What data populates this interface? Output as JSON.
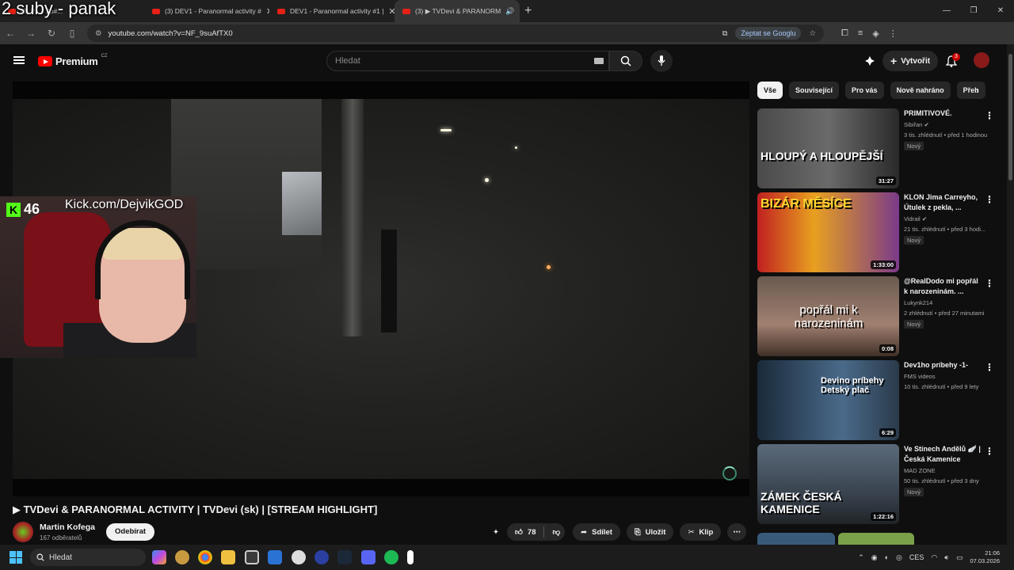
{
  "overlay_text": "2 suby - panak",
  "browser": {
    "tabs": [
      {
        "label": "(3) Ps... 2p#...",
        "active": false
      },
      {
        "label": "(3) DEV1 - Paranormal activity #",
        "active": false
      },
      {
        "label": "DEV1 - Paranormal activity #1 |",
        "active": false
      },
      {
        "label": "(3) ▶ TVDevi & PARANORM",
        "active": true
      }
    ],
    "url": "youtube.com/watch?v=NF_9suAfTX0",
    "ask_google": "Zeptat se Googlu"
  },
  "yt": {
    "logo": "Premium",
    "logo_region": "CZ",
    "search_placeholder": "Hledat",
    "create_label": "Vytvořit",
    "notif_count": "3"
  },
  "webcam": {
    "kick_count": "46",
    "kick_url": "Kick.com/DejvikGOD"
  },
  "video": {
    "title": "▶ TVDevi & PARANORMAL ACTIVITY | TVDevi (sk) | [STREAM HIGHLIGHT]",
    "channel": "Martin Kofega",
    "subs": "167 odběratelů",
    "subscribe": "Odebírat",
    "likes": "78",
    "share": "Sdílet",
    "save": "Uložit",
    "clip": "Klip"
  },
  "chips": [
    "Vše",
    "Související",
    "Pro vás",
    "Nově nahráno",
    "Přeh"
  ],
  "recommendations": [
    {
      "title": "PRIMITIVOVÉ.",
      "channel": "Sibiřan",
      "verified": true,
      "meta": "3 tis. zhlédnutí • před 1 hodinou",
      "badge": "Nový",
      "duration": "31:27",
      "thumb_text": "HLOUPÝ A HLOUPĚJŠÍ"
    },
    {
      "title": "KLON Jima Carreyho, Útulek z pekla, ...",
      "channel": "Vidrail",
      "verified": true,
      "meta": "21 tis. zhlédnutí • před 3 hodi...",
      "badge": "Nový",
      "duration": "1:33:00",
      "thumb_text": "BIZÁR MĚSÍCE"
    },
    {
      "title": "@RealDodo mi popřál k narozeninám. ...",
      "channel": "Lukynk214",
      "verified": false,
      "meta": "2 zhlédnutí • před 27 minutami",
      "badge": "Nový",
      "duration": "0:08",
      "thumb_text": "popřál mi k narozeninám"
    },
    {
      "title": "Dev1ho príbehy -1-",
      "channel": "FMS videos",
      "verified": false,
      "meta": "10 tis. zhlédnutí • před 9 lety",
      "badge": "",
      "duration": "6:29",
      "thumb_text": "Devino príbehy Detský plač"
    },
    {
      "title": "Ve Stínech Andělů 🪽 | Česká Kamenice",
      "channel": "MAD ZONE",
      "verified": false,
      "meta": "50 tis. zhlédnutí • před 3 dny",
      "badge": "Nový",
      "duration": "1:22:16",
      "thumb_text": "ZÁMEK ČESKÁ KAMENICE"
    }
  ],
  "taskbar": {
    "search": "Hledat",
    "lang": "CES",
    "time": "21:06",
    "date": "07.03.2026"
  }
}
